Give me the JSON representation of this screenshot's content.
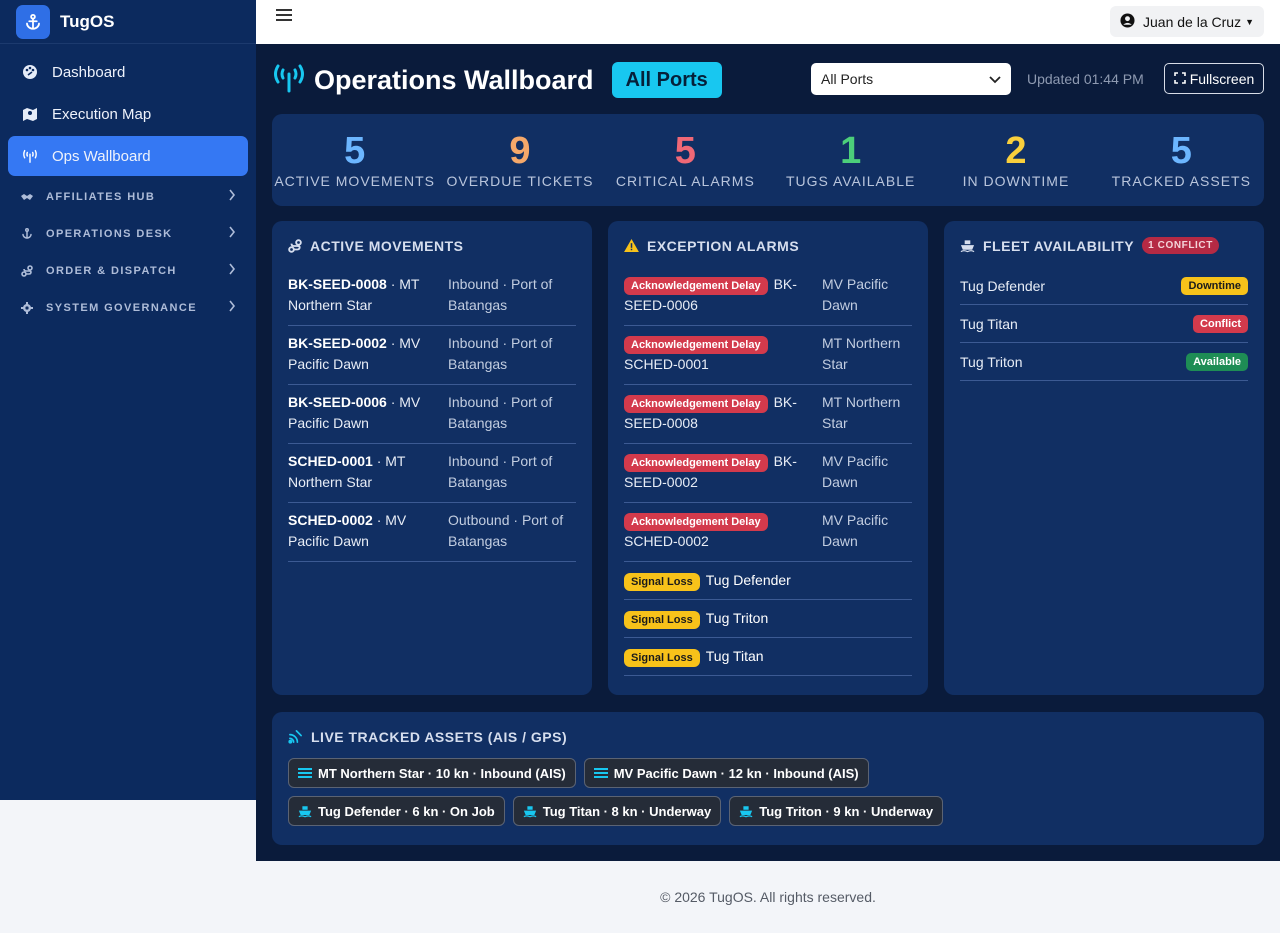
{
  "brand": {
    "name": "TugOS"
  },
  "sidebar": {
    "items": [
      {
        "label": "Dashboard",
        "icon": "palette-icon"
      },
      {
        "label": "Execution Map",
        "icon": "map-icon"
      },
      {
        "label": "Ops Wallboard",
        "icon": "broadcast-icon",
        "active": true
      }
    ],
    "groups": [
      {
        "label": "AFFILIATES HUB",
        "icon": "handshake-icon"
      },
      {
        "label": "OPERATIONS DESK",
        "icon": "anchor-icon"
      },
      {
        "label": "ORDER & DISPATCH",
        "icon": "route-icon"
      },
      {
        "label": "SYSTEM GOVERNANCE",
        "icon": "gear-icon"
      }
    ]
  },
  "topbar": {
    "user": "Juan de la Cruz"
  },
  "header": {
    "title": "Operations Wallboard",
    "port_pill": "All Ports",
    "port_select": "All Ports",
    "updated": "Updated 01:44 PM",
    "fullscreen": "Fullscreen"
  },
  "kpis": [
    {
      "value": "5",
      "label": "ACTIVE MOVEMENTS",
      "color": "#6cb6ff"
    },
    {
      "value": "9",
      "label": "OVERDUE TICKETS",
      "color": "#f5a86a"
    },
    {
      "value": "5",
      "label": "CRITICAL ALARMS",
      "color": "#f06876"
    },
    {
      "value": "1",
      "label": "TUGS AVAILABLE",
      "color": "#4ccf7a"
    },
    {
      "value": "2",
      "label": "IN DOWNTIME",
      "color": "#f9cf3c"
    },
    {
      "value": "5",
      "label": "TRACKED ASSETS",
      "color": "#6cb6ff"
    }
  ],
  "movements": {
    "title": "ACTIVE MOVEMENTS",
    "rows": [
      {
        "code": "BK-SEED-0008",
        "vessel": " · MT Northern Star",
        "dest": "Inbound · Port of Batangas"
      },
      {
        "code": "BK-SEED-0002",
        "vessel": " · MV Pacific Dawn",
        "dest": "Inbound · Port of Batangas"
      },
      {
        "code": "BK-SEED-0006",
        "vessel": " · MV Pacific Dawn",
        "dest": "Inbound · Port of Batangas"
      },
      {
        "code": "SCHED-0001",
        "vessel": " · MT Northern Star",
        "dest": "Inbound · Port of Batangas"
      },
      {
        "code": "SCHED-0002",
        "vessel": " · MV Pacific Dawn",
        "dest": "Outbound · Port of Batangas"
      }
    ]
  },
  "alarms": {
    "title": "EXCEPTION ALARMS",
    "rows": [
      {
        "badge": "Acknowledgement Delay",
        "ref": "BK-SEED-0006",
        "vessel": "MV Pacific Dawn"
      },
      {
        "badge": "Acknowledgement Delay",
        "ref": "SCHED-0001",
        "vessel": "MT Northern Star"
      },
      {
        "badge": "Acknowledgement Delay",
        "ref": "BK-SEED-0008",
        "vessel": "MT Northern Star"
      },
      {
        "badge": "Acknowledgement Delay",
        "ref": "BK-SEED-0002",
        "vessel": "MV Pacific Dawn"
      },
      {
        "badge": "Acknowledgement Delay",
        "ref": "SCHED-0002",
        "vessel": "MV Pacific Dawn"
      }
    ],
    "signal_rows": [
      {
        "badge": "Signal Loss",
        "asset": "Tug Defender"
      },
      {
        "badge": "Signal Loss",
        "asset": "Tug Triton"
      },
      {
        "badge": "Signal Loss",
        "asset": "Tug Titan"
      }
    ]
  },
  "fleet": {
    "title": "FLEET AVAILABILITY",
    "conflict_badge": "1 CONFLICT",
    "rows": [
      {
        "name": "Tug Defender",
        "status": "Downtime"
      },
      {
        "name": "Tug Titan",
        "status": "Conflict"
      },
      {
        "name": "Tug Triton",
        "status": "Available"
      }
    ]
  },
  "tracked": {
    "title": "LIVE TRACKED ASSETS (AIS / GPS)",
    "chips": [
      {
        "label": "MT Northern Star · 10 kn · Inbound (AIS)",
        "icon": "vessel-icon"
      },
      {
        "label": "MV Pacific Dawn · 12 kn · Inbound (AIS)",
        "icon": "vessel-icon"
      },
      {
        "label": "Tug Defender · 6 kn · On Job",
        "icon": "ship-icon"
      },
      {
        "label": "Tug Titan · 8 kn · Underway",
        "icon": "ship-icon"
      },
      {
        "label": "Tug Triton · 9 kn · Underway",
        "icon": "ship-icon"
      }
    ]
  },
  "footer": {
    "text": "© 2026 TugOS. All rights reserved."
  },
  "colors": {
    "accent": "#18c7f0",
    "sidebar": "#0c2a5e",
    "main_bg": "#0a1b3b",
    "card": "#112f63"
  }
}
